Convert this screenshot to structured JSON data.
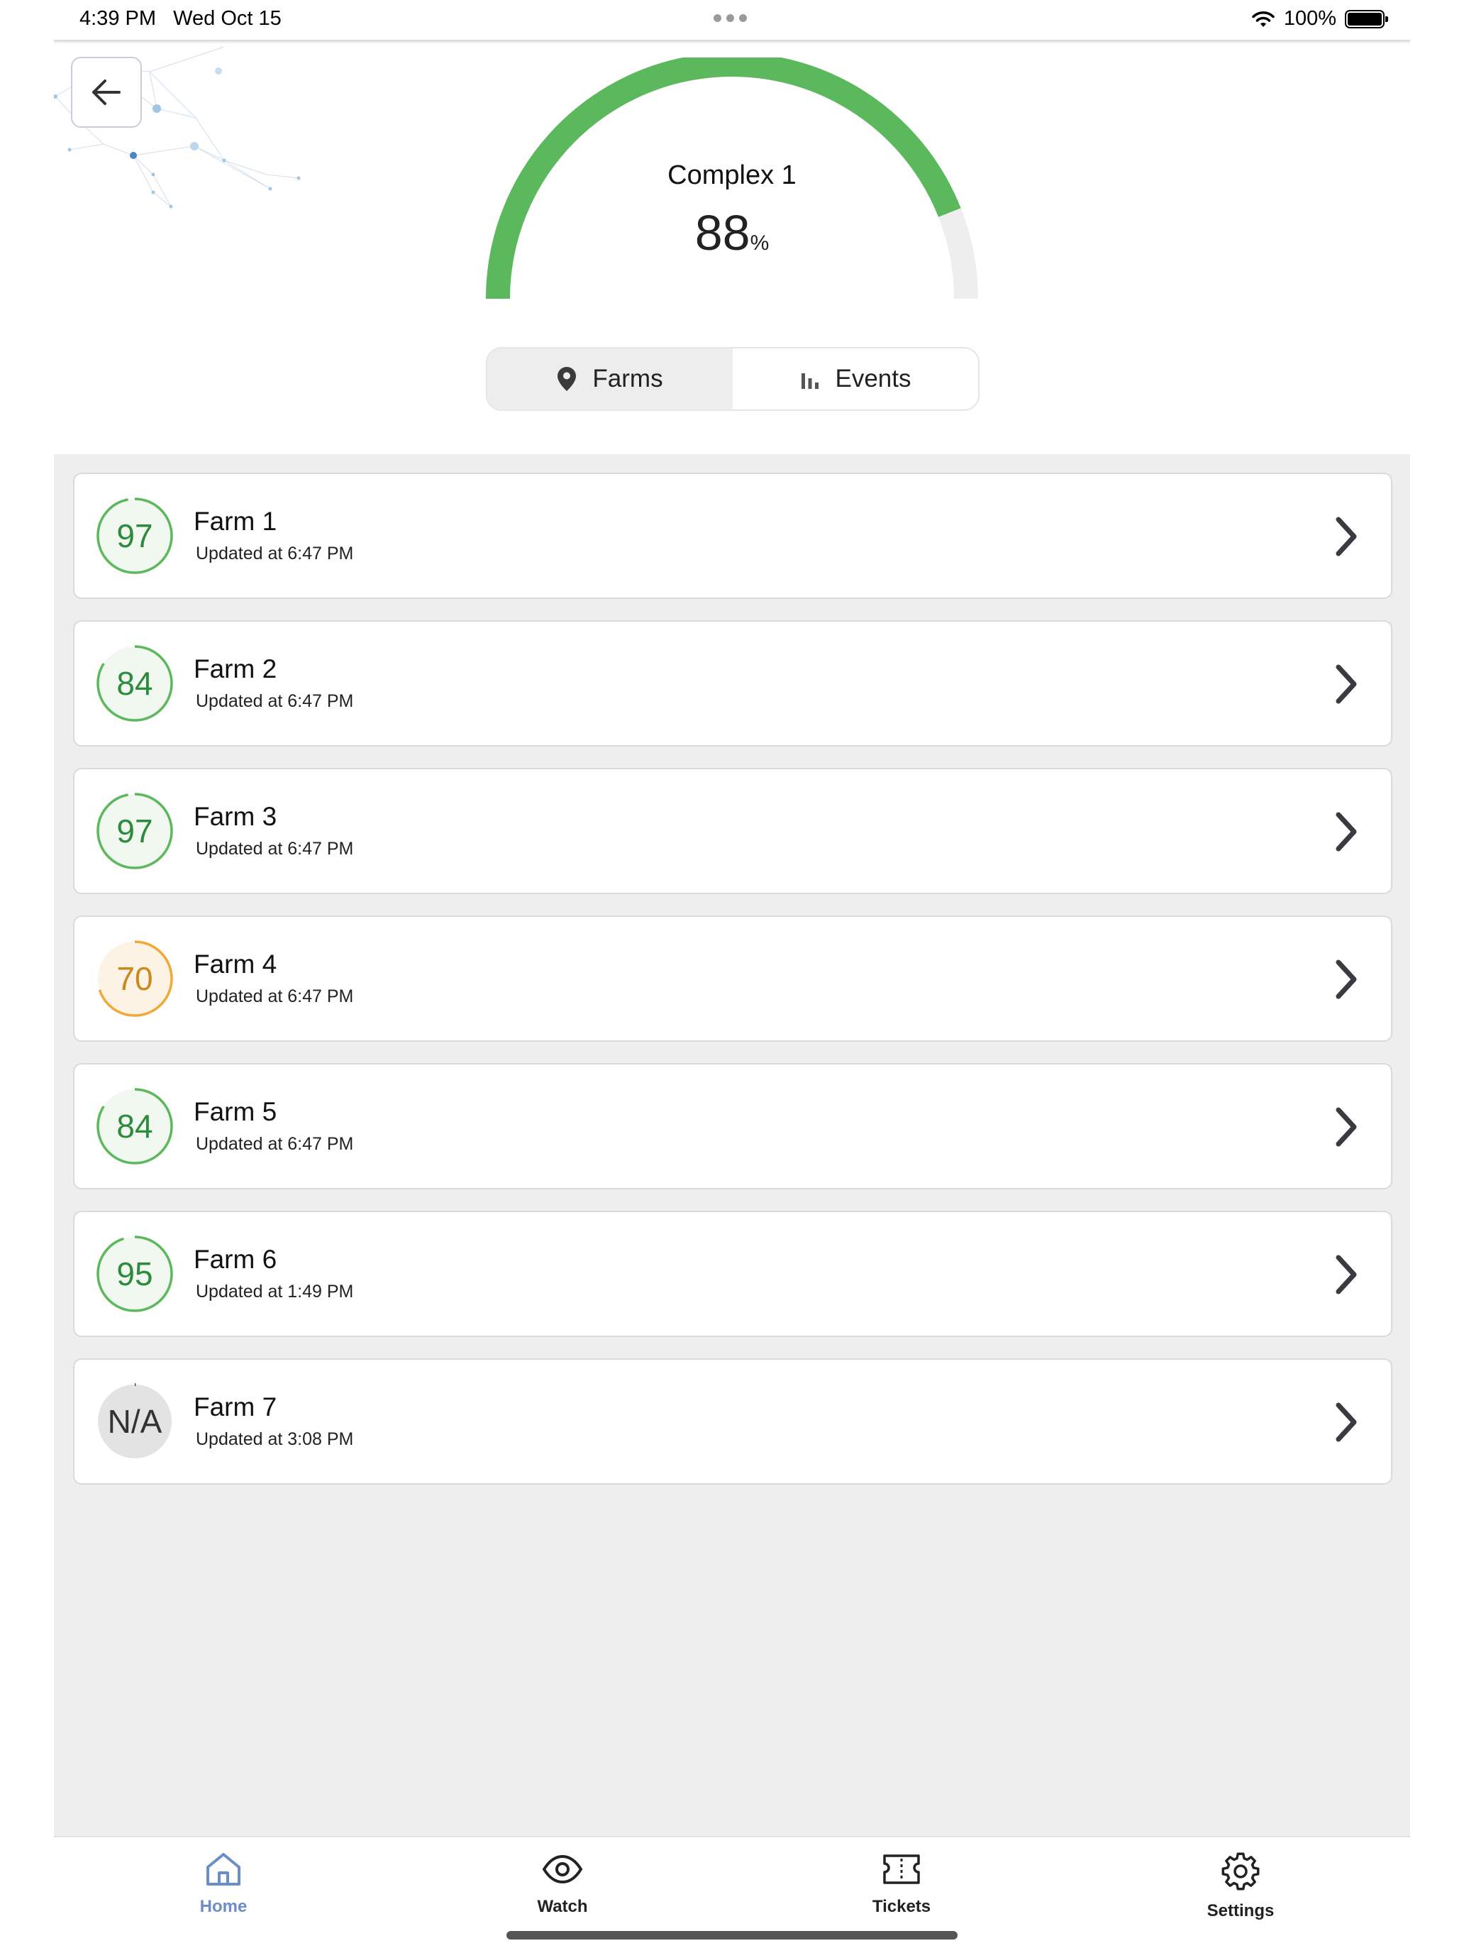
{
  "status_bar": {
    "time": "4:39 PM",
    "date": "Wed Oct 15",
    "battery": "100%"
  },
  "header": {
    "complex_name": "Complex 1",
    "score": "88",
    "score_unit": "%",
    "score_fraction": 0.88,
    "tabs": [
      {
        "label": "Farms",
        "icon": "location-pin-icon",
        "active": true
      },
      {
        "label": "Events",
        "icon": "bar-chart-icon",
        "active": false
      }
    ]
  },
  "farms": [
    {
      "name": "Farm 1",
      "score": "97",
      "updated": "Updated at 6:47 PM",
      "fraction": 0.97,
      "status": "good"
    },
    {
      "name": "Farm 2",
      "score": "84",
      "updated": "Updated at 6:47 PM",
      "fraction": 0.84,
      "status": "good"
    },
    {
      "name": "Farm 3",
      "score": "97",
      "updated": "Updated at 6:47 PM",
      "fraction": 0.97,
      "status": "good"
    },
    {
      "name": "Farm 4",
      "score": "70",
      "updated": "Updated at 6:47 PM",
      "fraction": 0.7,
      "status": "warning"
    },
    {
      "name": "Farm 5",
      "score": "84",
      "updated": "Updated at 6:47 PM",
      "fraction": 0.84,
      "status": "good"
    },
    {
      "name": "Farm 6",
      "score": "95",
      "updated": "Updated at 1:49 PM",
      "fraction": 0.95,
      "status": "good"
    },
    {
      "name": "Farm 7",
      "score": "N/A",
      "updated": "Updated at 3:08 PM",
      "fraction": 0,
      "status": "none"
    }
  ],
  "tab_bar": [
    {
      "label": "Home",
      "icon": "home-icon",
      "active": true
    },
    {
      "label": "Watch",
      "icon": "eye-icon",
      "active": false
    },
    {
      "label": "Tickets",
      "icon": "ticket-icon",
      "active": false
    },
    {
      "label": "Settings",
      "icon": "gear-icon",
      "active": false
    }
  ],
  "colors": {
    "good": "#5cb85c",
    "good_bg": "#f0f8f0",
    "good_text": "#2e8b3e",
    "warning": "#f0a836",
    "warning_bg": "#fdf3e4",
    "warning_text": "#c98a1e",
    "none_bg": "#e3e3e3",
    "gauge_track": "#eeeeee",
    "active_tab": "#6b8ec9"
  }
}
